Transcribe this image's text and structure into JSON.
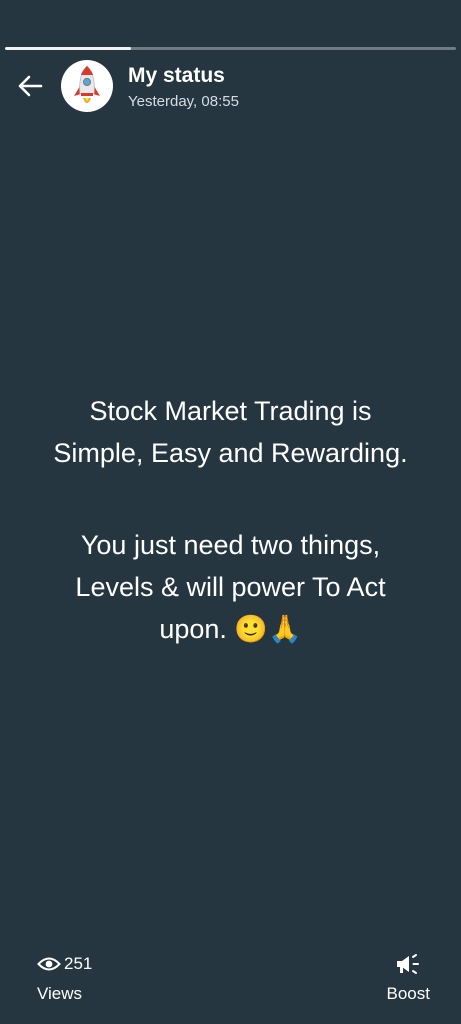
{
  "progress": {
    "segments": 1,
    "current_fill_fraction": 0.28
  },
  "header": {
    "title": "My status",
    "subtitle": "Yesterday, 08:55",
    "back_icon": "arrow-left-icon",
    "avatar_icon": "rocket-icon"
  },
  "status": {
    "paragraphs": [
      "Stock Market Trading is\nSimple, Easy and Rewarding.",
      "You just need two things,\nLevels & will power To Act\nupon. 🙂🙏"
    ],
    "background_color": "#253640"
  },
  "footer": {
    "views_count": "251",
    "views_label": "Views",
    "views_icon": "eye-icon",
    "boost_label": "Boost",
    "boost_icon": "megaphone-icon"
  }
}
